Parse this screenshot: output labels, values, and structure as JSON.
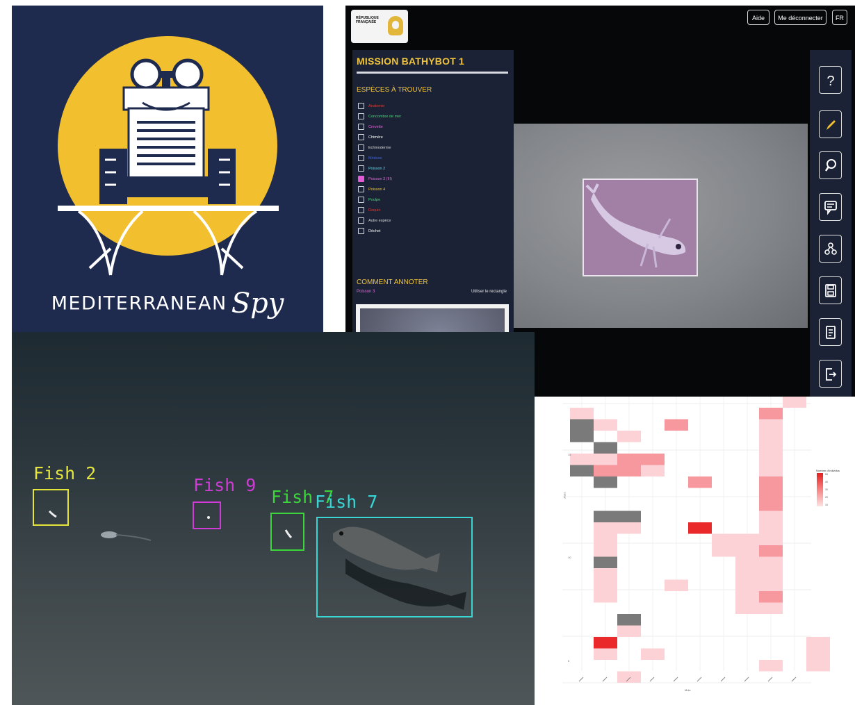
{
  "logo": {
    "word1": "MEDITERRANEAN",
    "word2": "Spy",
    "colors": {
      "background": "#1f2a4f",
      "sun": "#f2c02e",
      "line": "#ffffff"
    }
  },
  "app": {
    "header": {
      "gov_logo_text": "RÉPUBLIQUE FRANÇAISE",
      "help_label": "Aide",
      "logout_label": "Me déconnecter",
      "language_label": "FR"
    },
    "sidebar": {
      "mission_title": "MISSION BATHYBOT 1",
      "species_heading": "ESPÈCES À TROUVER",
      "species": [
        {
          "label": "Anatomie",
          "color": "#e23a2f",
          "checked": false
        },
        {
          "label": "Concombre de mer",
          "color": "#4fd37a",
          "checked": false
        },
        {
          "label": "Crevette",
          "color": "#e06ad6",
          "checked": false
        },
        {
          "label": "Chimère",
          "color": "#ffffff",
          "checked": false
        },
        {
          "label": "Echinoderme",
          "color": "#d9d9d9",
          "checked": false
        },
        {
          "label": "Méduse",
          "color": "#3b64e0",
          "checked": false
        },
        {
          "label": "Poisson 2",
          "color": "#6ad7e8",
          "checked": false
        },
        {
          "label": "Poisson 3 (III)",
          "color": "#e06ad6",
          "checked": true
        },
        {
          "label": "Poisson 4",
          "color": "#f0c43a",
          "checked": false
        },
        {
          "label": "Poulpe",
          "color": "#4fd37a",
          "checked": false
        },
        {
          "label": "Requin",
          "color": "#e23a2f",
          "checked": false
        },
        {
          "label": "Autre espèce",
          "color": "#d9d9d9",
          "checked": false
        },
        {
          "label": "Déchet",
          "color": "#ffffff",
          "checked": false
        }
      ],
      "howto_heading": "COMMENT ANNOTER",
      "howto_species": "Poisson 3",
      "howto_tip": "Utiliser le rectangle"
    },
    "toolbar": [
      "help-icon",
      "pencil-icon",
      "zoom-icon",
      "comment-icon",
      "share-icon",
      "save-icon",
      "list-icon",
      "exit-icon"
    ]
  },
  "detections": [
    {
      "label": "Fish 2",
      "color": "#e6e63a"
    },
    {
      "label": "Fish 9",
      "color": "#d03ad6"
    },
    {
      "label": "Fish 7",
      "color": "#3ad63a"
    },
    {
      "label": "Fish 7",
      "color": "#3ad6d6"
    }
  ],
  "heatmap": {
    "legend_title": "Nombre d'individus",
    "legend_ticks": [
      "50",
      "40",
      "30",
      "20",
      "10"
    ],
    "y_ticks": [
      "15",
      "10",
      "5",
      "1"
    ],
    "x_label": "Mois",
    "y_label": "Jours",
    "colors": {
      "low": "#fcd2d6",
      "mid": "#f6989e",
      "high": "#ea2a2a",
      "missing": "#7a7a7a"
    }
  }
}
